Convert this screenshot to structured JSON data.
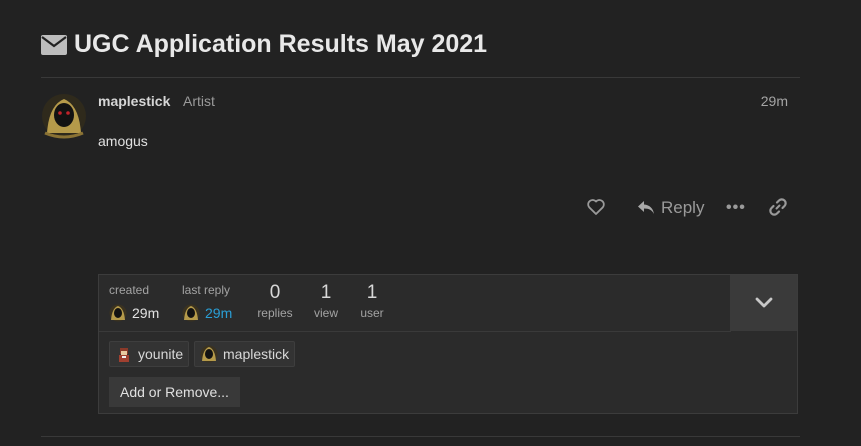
{
  "topic": {
    "title": "UGC Application Results May 2021",
    "icon": "envelope-icon"
  },
  "post": {
    "username": "maplestick",
    "user_title": "Artist",
    "date": "29m",
    "body": "amogus",
    "actions": {
      "like_icon": "heart-icon",
      "reply_label": "Reply",
      "more_label": "•••",
      "link_icon": "link-icon"
    }
  },
  "topic_map": {
    "created_label": "created",
    "created_value": "29m",
    "last_reply_label": "last reply",
    "last_reply_value": "29m",
    "replies_count": "0",
    "replies_label": "replies",
    "views_count": "1",
    "views_label": "view",
    "users_count": "1",
    "users_label": "user",
    "participants": [
      {
        "name": "younite"
      },
      {
        "name": "maplestick"
      }
    ],
    "add_remove_label": "Add or Remove..."
  },
  "colors": {
    "background": "#222222",
    "link_blue": "#2a9fd6",
    "muted": "#9a9a9a"
  }
}
